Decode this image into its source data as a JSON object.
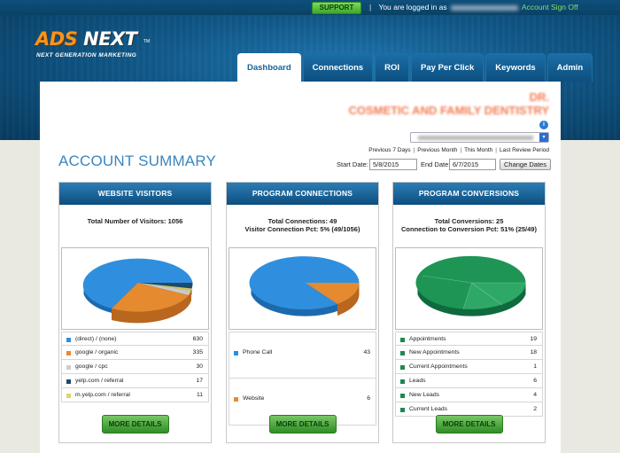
{
  "header": {
    "support_label": "SUPPORT",
    "login_prefix": "You are logged in as",
    "account_label": "Account",
    "signoff_label": "Sign Off"
  },
  "logo": {
    "text_a": "ADS ",
    "text_b": "NEXT",
    "tm": "TM",
    "tagline": "NEXT GENERATION MARKETING"
  },
  "tabs": [
    {
      "label": "Dashboard",
      "active": true
    },
    {
      "label": "Connections",
      "active": false
    },
    {
      "label": "ROI",
      "active": false
    },
    {
      "label": "Pay Per Click",
      "active": false
    },
    {
      "label": "Keywords",
      "active": false
    },
    {
      "label": "Admin",
      "active": false
    }
  ],
  "practice": {
    "name_line1": "DR.",
    "name_line2": "COSMETIC AND FAMILY DENTISTRY",
    "info_icon": "info-icon"
  },
  "period_links": [
    "Previous 7 Days",
    "Previous Month",
    "This Month",
    "Last Review Period"
  ],
  "summary_title": "ACCOUNT SUMMARY",
  "dates": {
    "start_label": "Start Date:",
    "start_value": "5/8/2015",
    "end_label": "End Date:",
    "end_value": "6/7/2015",
    "change_label": "Change Dates"
  },
  "panels": [
    {
      "title": "WEBSITE VISITORS",
      "stat1": "Total Number of Visitors: 1056",
      "stat2": "",
      "more": "MORE DETAILS",
      "legend": [
        {
          "label": "(direct) / (none)",
          "value": "630",
          "color": "#2f8fde"
        },
        {
          "label": "google / organic",
          "value": "335",
          "color": "#e78b2f"
        },
        {
          "label": "google / cpc",
          "value": "30",
          "color": "#cfcfcf"
        },
        {
          "label": "yelp.com / referral",
          "value": "17",
          "color": "#1c4c6b"
        },
        {
          "label": "m.yelp.com / referral",
          "value": "11",
          "color": "#e4d36a"
        }
      ]
    },
    {
      "title": "PROGRAM CONNECTIONS",
      "stat1": "Total Connections: 49",
      "stat2": "Visitor Connection Pct: 5% (49/1056)",
      "more": "MORE DETAILS",
      "legend": [
        {
          "label": "Phone Call",
          "value": "43",
          "color": "#2f8fde"
        },
        {
          "label": "Website",
          "value": "6",
          "color": "#e78b2f"
        }
      ]
    },
    {
      "title": "PROGRAM CONVERSIONS",
      "stat1": "Total Conversions: 25",
      "stat2": "Connection to Conversion Pct: 51% (25/49)",
      "more": "MORE DETAILS",
      "legend": [
        {
          "label": "Appointments",
          "value": "19",
          "color": "#1a8a52"
        },
        {
          "label": "New Appointments",
          "value": "18",
          "color": "#1a8a52"
        },
        {
          "label": "Current Appointments",
          "value": "1",
          "color": "#1a8a52"
        },
        {
          "label": "Leads",
          "value": "6",
          "color": "#1a8a52"
        },
        {
          "label": "New Leads",
          "value": "4",
          "color": "#1a8a52"
        },
        {
          "label": "Current Leads",
          "value": "2",
          "color": "#1a8a52"
        }
      ]
    }
  ],
  "chart_data": [
    {
      "type": "pie",
      "categories": [
        "(direct) / (none)",
        "google / organic",
        "google / cpc",
        "yelp.com / referral",
        "m.yelp.com / referral"
      ],
      "values": [
        630,
        335,
        30,
        17,
        11
      ],
      "title": "WEBSITE VISITORS"
    },
    {
      "type": "pie",
      "categories": [
        "Phone Call",
        "Website"
      ],
      "values": [
        43,
        6
      ],
      "title": "PROGRAM CONNECTIONS"
    },
    {
      "type": "pie",
      "categories": [
        "Appointments",
        "Leads"
      ],
      "values": [
        19,
        6
      ],
      "title": "PROGRAM CONVERSIONS"
    }
  ]
}
